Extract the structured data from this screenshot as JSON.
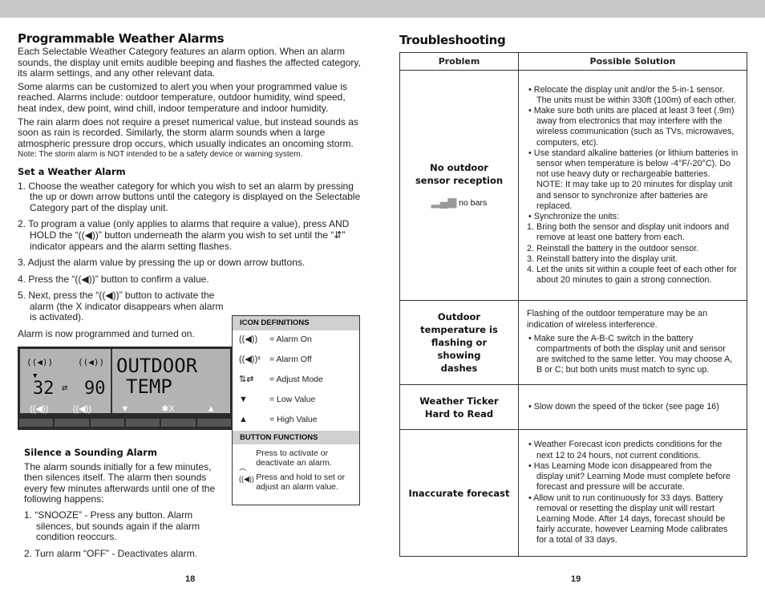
{
  "left": {
    "title": "Programmable Weather Alarms",
    "paragraphs": [
      "Each Selectable Weather Category features an alarm option. When an alarm sounds, the display unit emits audible beeping and flashes the affected category, its alarm settings, and any other relevant data.",
      "Some alarms can be customized to alert you when your programmed value is reached. Alarms include: outdoor temperature, outdoor humidity, wind speed, heat index, dew point, wind chill, indoor temperature and indoor humidity.",
      "The rain alarm does not require a preset numerical value, but instead sounds as soon as rain is recorded. Similarly, the storm alarm sounds when a large atmospheric pressure drop occurs, which usually indicates an oncoming storm."
    ],
    "note": "Note: The storm alarm is NOT intended to be a safety device or warning system.",
    "set_heading": "Set a Weather Alarm",
    "steps": [
      "1. Choose the weather category for which you wish to set an alarm by pressing the up or down arrow buttons until the category is displayed on the Selectable Category part of the display unit.",
      "2. To program a value (only applies to alarms that require a value), press AND HOLD the “((◀))” button underneath the alarm you wish to set until the “⇵” indicator appears and the alarm setting flashes.",
      "3. Adjust the alarm value by pressing the up or down arrow buttons.",
      "4. Press the “((◀))” button to confirm a value.",
      "5. Next, press the “((◀))” button to activate the alarm (the X indicator disappears when alarm is activated)."
    ],
    "done": "Alarm is now programmed and turned on.",
    "lcd": {
      "low": "32",
      "high": "90",
      "line1": "OUTDOOR",
      "line2": "TEMP"
    },
    "icon_definitions": {
      "heading": "ICON DEFINITIONS",
      "items": [
        {
          "icon": "alarm-on-icon",
          "label": "= Alarm On"
        },
        {
          "icon": "alarm-off-icon",
          "label": "= Alarm Off"
        },
        {
          "icon": "adjust-mode-icon",
          "label": "= Adjust Mode"
        },
        {
          "icon": "low-value-icon",
          "label": "= Low Value"
        },
        {
          "icon": "high-value-icon",
          "label": "= High Value"
        }
      ],
      "button_heading": "BUTTON FUNCTIONS",
      "button_text1": "Press to activate or deactivate an alarm.",
      "button_text2": "Press and hold to set or adjust an alarm value."
    },
    "silence_heading": "Silence a Sounding Alarm",
    "silence_text": "The alarm sounds initially for a few minutes, then silences itself. The alarm then sounds every few minutes afterwards until one of the following happens:",
    "silence_steps": [
      "1. “SNOOZE” - Press any button. Alarm silences, but sounds again if the alarm condition reoccurs.",
      "2. Turn alarm “OFF” - Deactivates alarm."
    ],
    "page": "18"
  },
  "right": {
    "title": "Troubleshooting",
    "headers": [
      "Problem",
      "Possible Solution"
    ],
    "rows": [
      {
        "problem": "No outdoor sensor reception",
        "extra": "no bars",
        "solution": [
          "• Relocate the display unit and/or the 5-in-1 sensor. The units must be within 330ft (100m) of each other.",
          "• Make sure both units are placed at least 3 feet (.9m) away from electronics that may interfere with the wireless communication (such as TVs, microwaves, computers, etc).",
          "• Use standard alkaline batteries (or lithium batteries in sensor when temperature is below -4°F/-20°C). Do not use heavy duty or rechargeable batteries. NOTE: It may take up to 20 minutes for display unit and sensor to synchronize after batteries are replaced.",
          "• Synchronize the units:",
          "1. Bring both the sensor and display unit indoors and remove at least one battery from each.",
          "2. Reinstall the battery in the outdoor sensor.",
          "3. Reinstall battery into the display unit.",
          "4. Let the units sit within a couple feet of each other for about 20 minutes to gain a strong connection."
        ]
      },
      {
        "problem": "Outdoor temperature is flashing or showing dashes",
        "solution": [
          "Flashing of the outdoor temperature may be an indication of wireless interference.",
          "• Make sure the A-B-C switch in the battery compartments of both the display unit and sensor are switched to the same letter. You may choose A, B or C; but both units must match to sync up."
        ]
      },
      {
        "problem": "Weather Ticker Hard to Read",
        "solution": [
          "• Slow down the speed of the ticker (see page 16)"
        ]
      },
      {
        "problem": "Inaccurate forecast",
        "solution": [
          "• Weather Forecast icon predicts conditions for the next 12 to 24 hours, not current conditions.",
          "• Has Learning Mode icon disappeared from the display unit? Learning Mode must complete before forecast and pressure will be accurate.",
          "• Allow unit to run continuously for 33 days. Battery removal or resetting the display unit will restart Learning Mode. After 14 days, forecast should be fairly accurate, however Learning Mode calibrates for a total of 33 days."
        ]
      }
    ],
    "page": "19"
  }
}
